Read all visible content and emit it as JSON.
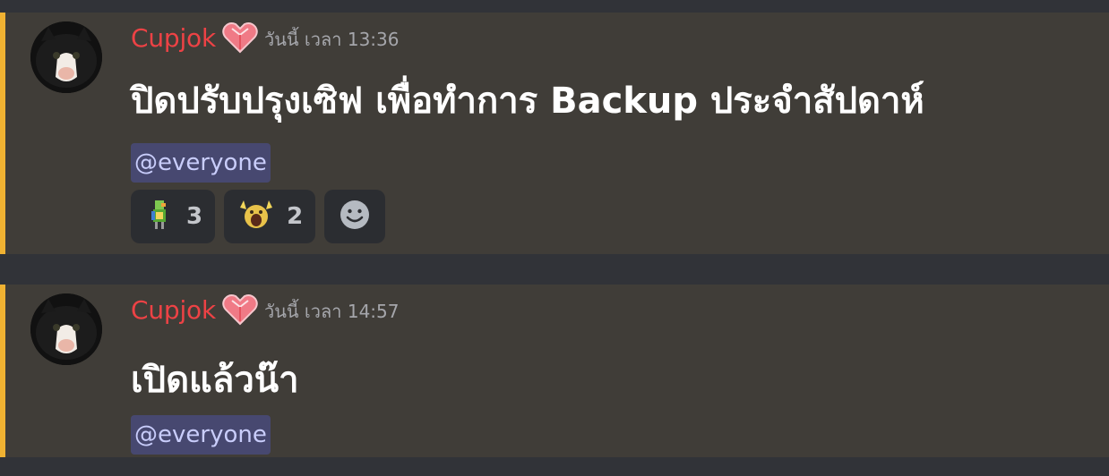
{
  "messages": [
    {
      "username": "Cupjok",
      "badge_icon": "heart-icon",
      "timestamp": "วันนี้ เวลา 13:36",
      "content": "ปิดปรับปรุงเซิฟ เพื่อทำการ Backup ประจำสัปดาห์",
      "mention": "@everyone",
      "reactions": [
        {
          "emoji": "parrot-emoji",
          "count": "3"
        },
        {
          "emoji": "screaming-face-emoji",
          "count": "2"
        }
      ],
      "add_reaction_icon": "smiley-add-reaction-icon"
    },
    {
      "username": "Cupjok",
      "badge_icon": "heart-icon",
      "timestamp": "วันนี้ เวลา 14:57",
      "content": "เปิดแล้วน๊า",
      "mention": "@everyone"
    }
  ],
  "colors": {
    "background": "#313338",
    "message_highlight": "#403d38",
    "accent_bar": "#f0b232",
    "username": "#ed4245",
    "mention_bg": "#5865f2",
    "reaction_bg": "#2b2d31"
  }
}
